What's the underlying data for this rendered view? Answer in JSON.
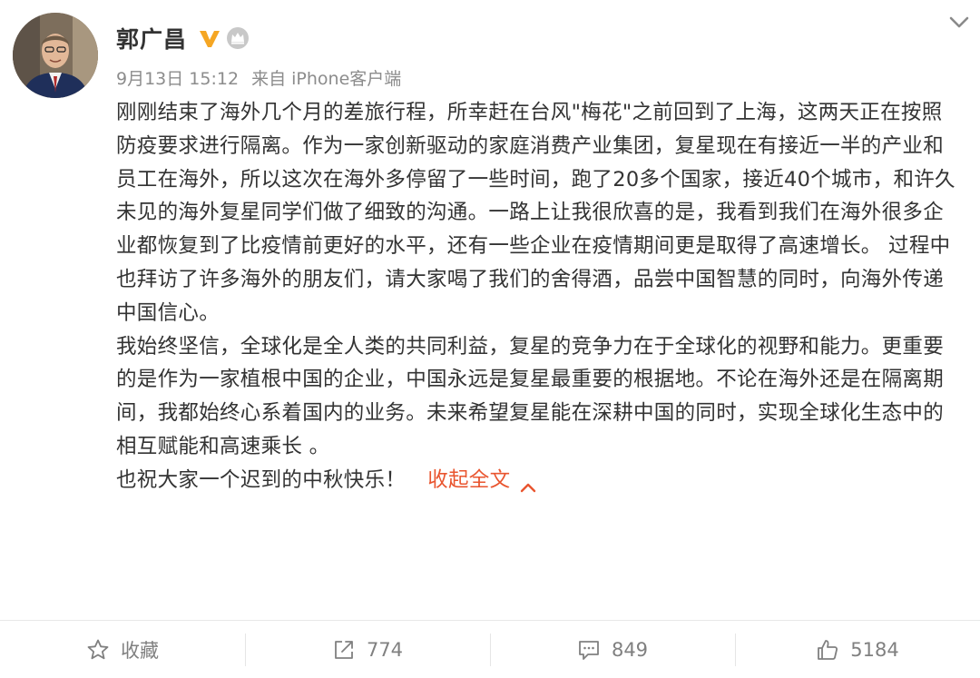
{
  "post": {
    "username": "郭广昌",
    "date": "9月13日 15:12",
    "source": "来自 iPhone客户端",
    "paragraphs": [
      "刚刚结束了海外几个月的差旅行程，所幸赶在台风\"梅花\"之前回到了上海，这两天正在按照防疫要求进行隔离。作为一家创新驱动的家庭消费产业集团，复星现在有接近一半的产业和员工在海外，所以这次在海外多停留了一些时间，跑了20多个国家，接近40个城市，和许久未见的海外复星同学们做了细致的沟通。一路上让我很欣喜的是，我看到我们在海外很多企业都恢复到了比疫情前更好的水平，还有一些企业在疫情期间更是取得了高速增长。 过程中也拜访了许多海外的朋友们，请大家喝了我们的舍得酒，品尝中国智慧的同时，向海外传递中国信心。",
      "我始终坚信，全球化是全人类的共同利益，复星的竞争力在于全球化的视野和能力。更重要的是作为一家植根中国的企业，中国永远是复星最重要的根据地。不论在海外还是在隔离期间，我都始终心系着国内的业务。未来希望复星能在深耕中国的同时，实现全球化生态中的相互赋能和高速乘长 。"
    ],
    "closing": "也祝大家一个迟到的中秋快乐！",
    "collapse_label": "收起全文"
  },
  "footer": {
    "favorite_label": "收藏",
    "repost_count": "774",
    "comment_count": "849",
    "like_count": "5184"
  },
  "colors": {
    "accent": "#e9552f",
    "vip_gold": "#f5a623",
    "text": "#333333",
    "meta": "#8c8c8c"
  },
  "icons": {
    "badge": "vip-v-icon",
    "crown": "crown-icon",
    "more": "chevron-down-icon",
    "favorite": "star-icon",
    "repost": "share-arrow-icon",
    "comment": "speech-bubble-icon",
    "like": "thumbs-up-icon"
  }
}
